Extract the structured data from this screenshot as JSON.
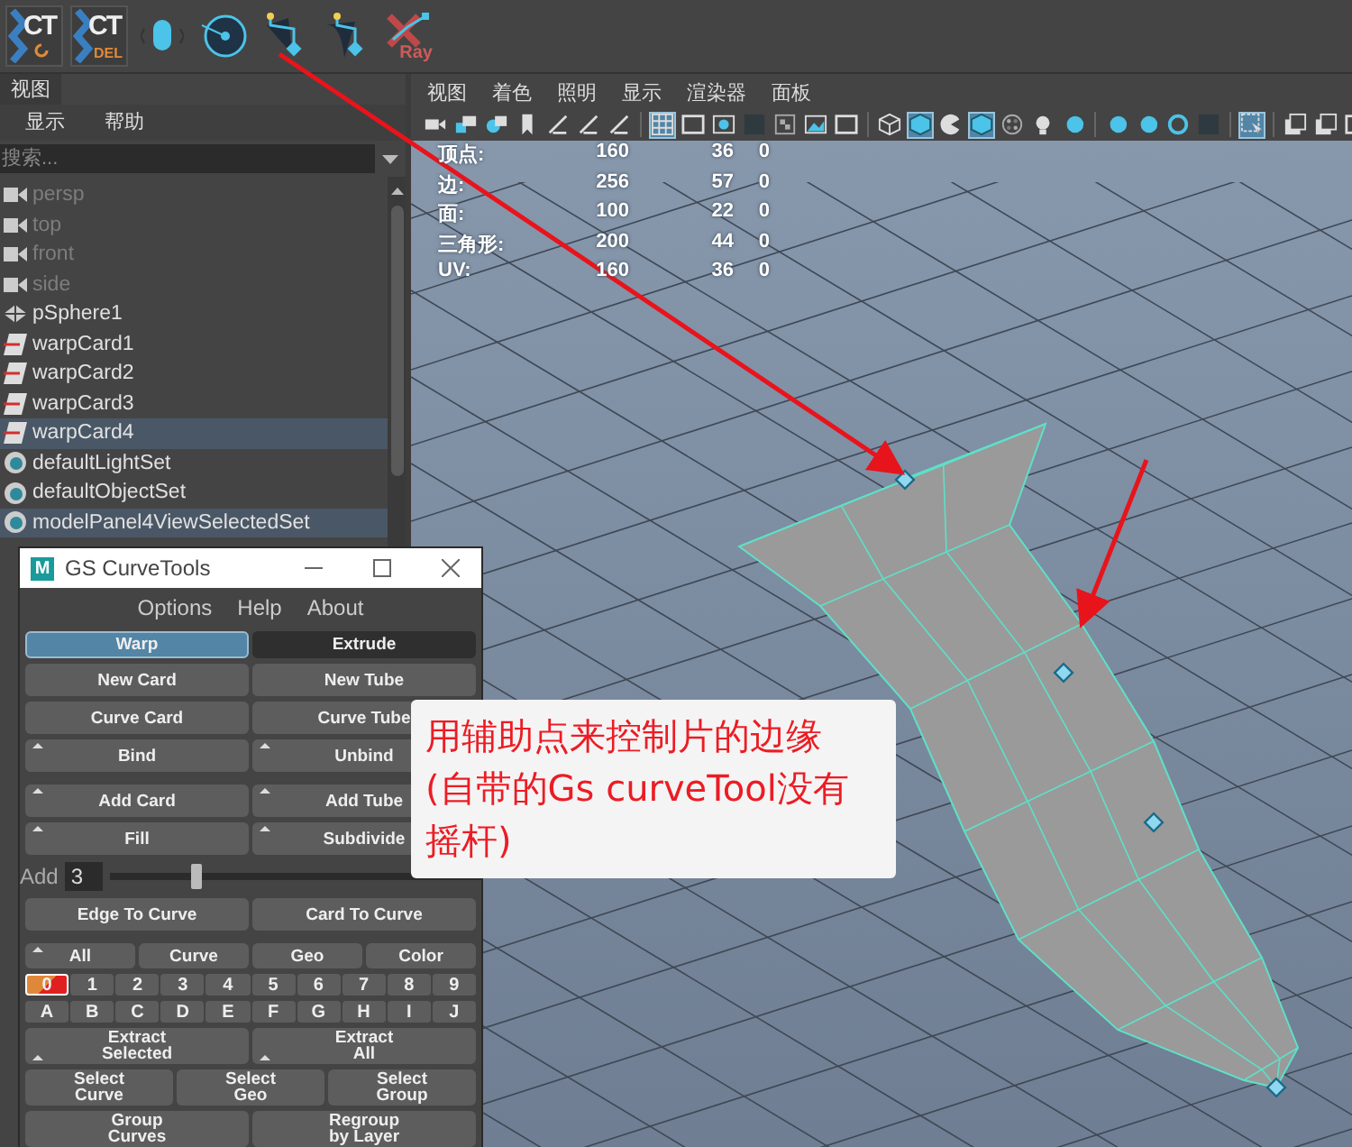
{
  "toolbar": [
    {
      "kind": "ct-refresh",
      "label": "CT"
    },
    {
      "kind": "ct-del",
      "label": "CT",
      "sub": "DEL"
    },
    {
      "kind": "mouse"
    },
    {
      "kind": "target"
    },
    {
      "kind": "curve-pin"
    },
    {
      "kind": "curve-pin-wide"
    },
    {
      "kind": "xray",
      "sub": "Ray"
    }
  ],
  "outliner": {
    "tab": "视图",
    "menu": [
      "显示",
      "帮助"
    ],
    "search": {
      "placeholder": "搜索..."
    },
    "items": [
      {
        "kind": "camera",
        "label": "persp",
        "dimmed": true,
        "selected": false
      },
      {
        "kind": "camera",
        "label": "top",
        "dimmed": true,
        "selected": false
      },
      {
        "kind": "camera",
        "label": "front",
        "dimmed": true,
        "selected": false
      },
      {
        "kind": "camera",
        "label": "side",
        "dimmed": true,
        "selected": false
      },
      {
        "kind": "mesh",
        "label": "pSphere1",
        "dimmed": false,
        "selected": false
      },
      {
        "kind": "card",
        "label": "warpCard1",
        "dimmed": false,
        "selected": false
      },
      {
        "kind": "card",
        "label": "warpCard2",
        "dimmed": false,
        "selected": false
      },
      {
        "kind": "card",
        "label": "warpCard3",
        "dimmed": false,
        "selected": false
      },
      {
        "kind": "card",
        "label": "warpCard4",
        "dimmed": false,
        "selected": true
      },
      {
        "kind": "set",
        "label": "defaultLightSet",
        "dimmed": false,
        "selected": false
      },
      {
        "kind": "set",
        "label": "defaultObjectSet",
        "dimmed": false,
        "selected": false
      },
      {
        "kind": "set",
        "label": "modelPanel4ViewSelectedSet",
        "dimmed": false,
        "selected": true
      }
    ]
  },
  "viewport": {
    "menu": [
      "视图",
      "着色",
      "照明",
      "显示",
      "渲染器",
      "面板"
    ],
    "icons": [
      {
        "kind": "camera",
        "selected": false
      },
      {
        "kind": "camera-lock",
        "selected": false
      },
      {
        "kind": "camera-gear",
        "selected": false
      },
      {
        "kind": "bookmark",
        "selected": false
      },
      {
        "kind": "tool",
        "selected": false
      },
      {
        "kind": "tool",
        "selected": false
      },
      {
        "kind": "tool",
        "selected": false
      },
      {
        "kind": "sep"
      },
      {
        "kind": "grid",
        "selected": true
      },
      {
        "kind": "frame",
        "selected": false
      },
      {
        "kind": "dot",
        "selected": false
      },
      {
        "kind": "square",
        "selected": false
      },
      {
        "kind": "checker"
      },
      {
        "kind": "image",
        "selected": false
      },
      {
        "kind": "frame",
        "selected": false
      },
      {
        "kind": "sep"
      },
      {
        "kind": "wire-cube",
        "selected": false
      },
      {
        "kind": "cube",
        "selected": true
      },
      {
        "kind": "pie",
        "selected": false
      },
      {
        "kind": "cube",
        "selected": true
      },
      {
        "kind": "checker-ball"
      },
      {
        "kind": "bulb",
        "selected": false
      },
      {
        "kind": "ball",
        "selected": false
      },
      {
        "kind": "sep"
      },
      {
        "kind": "ball",
        "selected": false
      },
      {
        "kind": "ball",
        "selected": false
      },
      {
        "kind": "ring",
        "selected": false
      },
      {
        "kind": "square",
        "selected": false
      },
      {
        "kind": "sep"
      },
      {
        "kind": "cursor",
        "selected": true
      },
      {
        "kind": "sep"
      },
      {
        "kind": "window",
        "selected": false
      },
      {
        "kind": "window",
        "selected": false
      },
      {
        "kind": "frame",
        "selected": false
      }
    ],
    "stats": [
      {
        "label": "顶点:",
        "values": [
          "160",
          "36",
          "0"
        ]
      },
      {
        "label": "边:",
        "values": [
          "256",
          "57",
          "0"
        ]
      },
      {
        "label": "面:",
        "values": [
          "100",
          "22",
          "0"
        ]
      },
      {
        "label": "三角形:",
        "values": [
          "200",
          "44",
          "0"
        ]
      },
      {
        "label": "UV:",
        "values": [
          "160",
          "36",
          "0"
        ]
      }
    ]
  },
  "curvetools": {
    "logo": "M",
    "title": "GS CurveTools",
    "menu": [
      "Options",
      "Help",
      "About"
    ],
    "rows": [
      {
        "kind": "tabs",
        "items": [
          {
            "label": "Warp",
            "selected": true
          },
          {
            "label": "Extrude",
            "selected": false
          }
        ]
      },
      {
        "kind": "buttons",
        "items": [
          {
            "label": "New Card"
          },
          {
            "label": "New Tube"
          }
        ]
      },
      {
        "kind": "buttons",
        "items": [
          {
            "label": "Curve Card"
          },
          {
            "label": "Curve Tube"
          }
        ]
      },
      {
        "kind": "buttons",
        "items": [
          {
            "label": "Bind",
            "has_menu": true
          },
          {
            "label": "Unbind",
            "has_menu": true
          }
        ]
      },
      {
        "kind": "buttons",
        "items": [
          {
            "label": "Add Card",
            "has_menu": true
          },
          {
            "label": "Add Tube",
            "has_menu": true
          }
        ]
      },
      {
        "kind": "buttons",
        "items": [
          {
            "label": "Fill",
            "has_menu": true
          },
          {
            "label": "Subdivide",
            "has_menu": true
          }
        ]
      },
      {
        "kind": "slider",
        "label": "Add",
        "value": "3",
        "level": 0.23
      },
      {
        "kind": "buttons",
        "items": [
          {
            "label": "Edge To Curve"
          },
          {
            "label": "Card To Curve"
          }
        ]
      },
      {
        "kind": "small",
        "items": [
          {
            "label": "All",
            "has_menu": true
          },
          {
            "label": "Curve"
          },
          {
            "label": "Geo"
          },
          {
            "label": "Color"
          }
        ]
      },
      {
        "kind": "layers",
        "items": [
          {
            "label": "0",
            "selected": true
          },
          {
            "label": "1",
            "selected": false
          },
          {
            "label": "2",
            "selected": false
          },
          {
            "label": "3",
            "selected": false
          },
          {
            "label": "4",
            "selected": false
          },
          {
            "label": "5",
            "selected": false
          },
          {
            "label": "6",
            "selected": false
          },
          {
            "label": "7",
            "selected": false
          },
          {
            "label": "8",
            "selected": false
          },
          {
            "label": "9",
            "selected": false
          }
        ]
      },
      {
        "kind": "layers",
        "items": [
          {
            "label": "A",
            "selected": false
          },
          {
            "label": "B",
            "selected": false
          },
          {
            "label": "C",
            "selected": false
          },
          {
            "label": "D",
            "selected": false
          },
          {
            "label": "E",
            "selected": false
          },
          {
            "label": "F",
            "selected": false
          },
          {
            "label": "G",
            "selected": false
          },
          {
            "label": "H",
            "selected": false
          },
          {
            "label": "I",
            "selected": false
          },
          {
            "label": "J",
            "selected": false
          }
        ]
      },
      {
        "kind": "double",
        "items": [
          {
            "label": "Extract\nSelected",
            "has_menu": true
          },
          {
            "label": "Extract\nAll",
            "has_menu": true
          }
        ]
      },
      {
        "kind": "double",
        "items": [
          {
            "label": "Select\nCurve"
          },
          {
            "label": "Select\nGeo"
          },
          {
            "label": "Select\nGroup"
          }
        ]
      },
      {
        "kind": "double",
        "items": [
          {
            "label": "Group\nCurves"
          },
          {
            "label": "Regroup\nby Layer"
          }
        ]
      }
    ]
  },
  "callout": {
    "lines": [
      "用辅助点来控制片的边缘",
      "(自带的Gs curveTool没有",
      "摇杆)"
    ]
  }
}
